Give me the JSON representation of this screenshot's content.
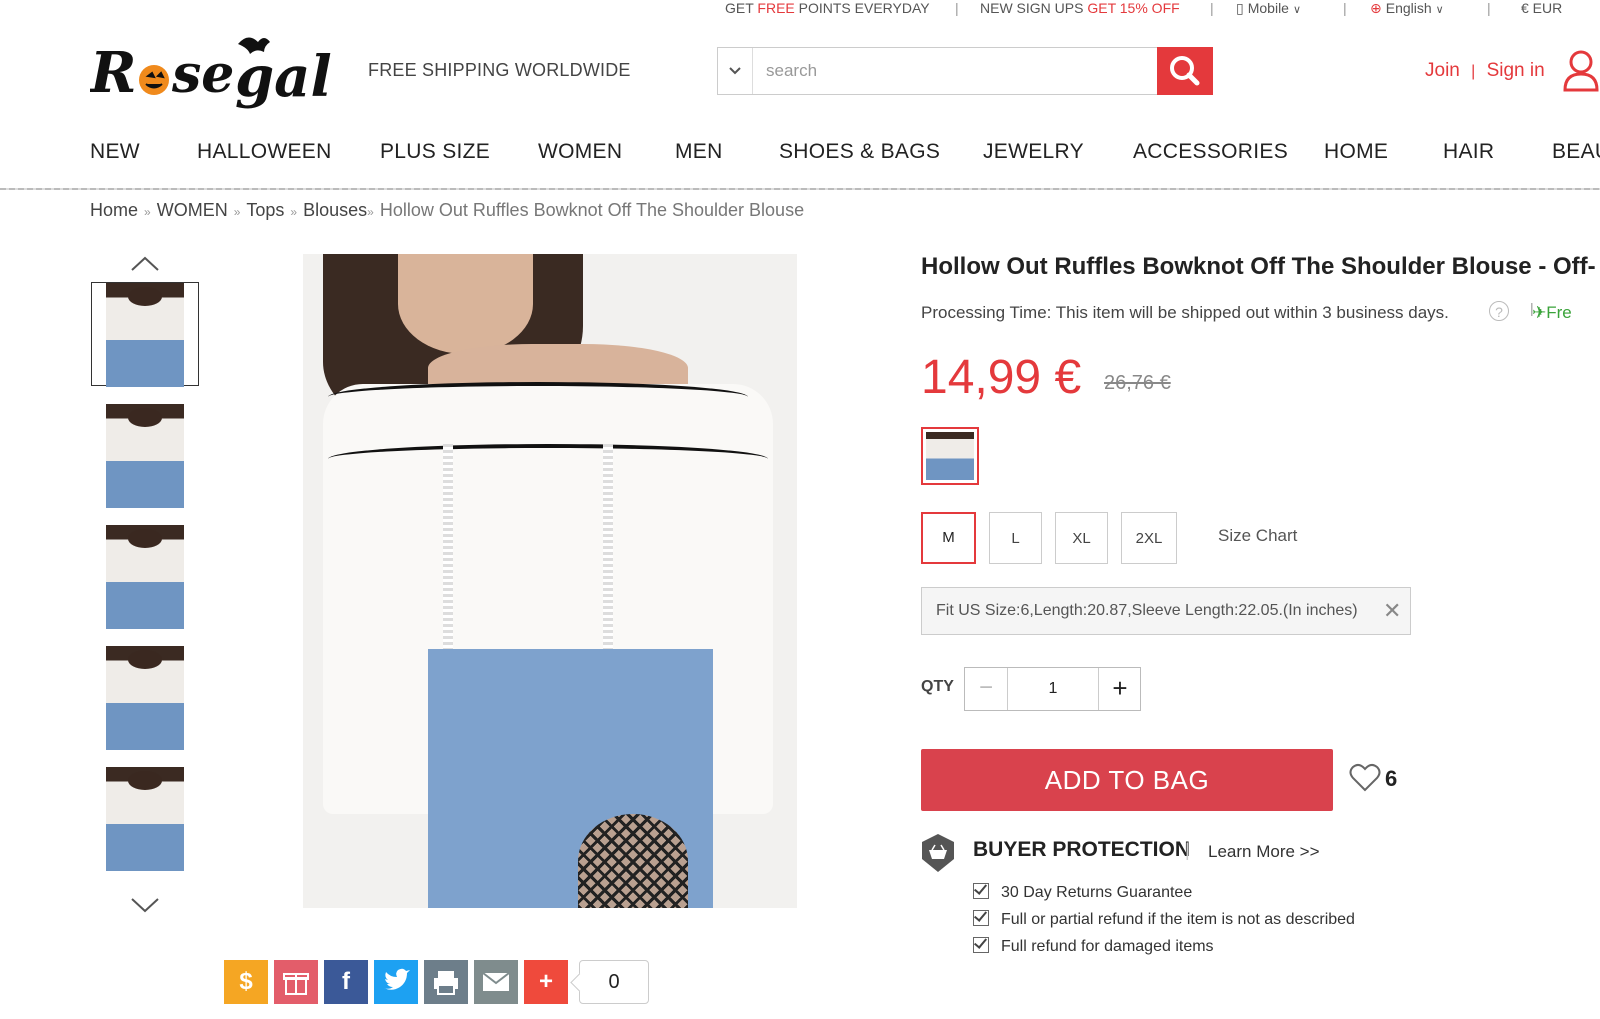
{
  "topbar": {
    "points_a": "GET ",
    "points_b": "FREE",
    "points_c": " POINTS EVERYDAY",
    "signup_a": "NEW SIGN UPS ",
    "signup_b": "GET 15% OFF",
    "mobile": "Mobile",
    "language": "English",
    "currency": "€ EUR"
  },
  "header": {
    "logo_text": "Rosegal",
    "free_shipping": "FREE SHIPPING WORLDWIDE",
    "search_placeholder": "search",
    "join": "Join",
    "signin": "Sign in"
  },
  "nav": [
    "NEW",
    "HALLOWEEN",
    "PLUS SIZE",
    "WOMEN",
    "MEN",
    "SHOES & BAGS",
    "JEWELRY",
    "ACCESSORIES",
    "HOME",
    "HAIR",
    "BEAU"
  ],
  "breadcrumb": {
    "home": "Home",
    "women": "WOMEN",
    "tops": "Tops",
    "blouses": "Blouses",
    "current": "Hollow Out Ruffles Bowknot Off The Shoulder Blouse"
  },
  "product": {
    "title": "Hollow Out Ruffles Bowknot Off The Shoulder Blouse - Off-",
    "processing": "Processing Time: This item will be shipped out within 3 business days.",
    "help": "?",
    "free": "Fre",
    "price": "14,99 €",
    "old_price": "26,76 €",
    "sizes": [
      "M",
      "L",
      "XL",
      "2XL"
    ],
    "selected_size": "M",
    "size_chart": "Size Chart",
    "fit": "Fit US Size:6,Length:20.87,Sleeve Length:22.05.(In inches)",
    "qty_label": "QTY",
    "qty": "1",
    "add_to_bag": "ADD TO BAG",
    "wish_count": "6"
  },
  "protection": {
    "title": "BUYER PROTECTION",
    "learn_more": "Learn More >>",
    "items": [
      "30 Day Returns Guarantee",
      "Full or partial refund if the item is not as described",
      "Full refund for damaged items"
    ]
  },
  "share": {
    "count": "0"
  },
  "colors": {
    "accent": "#e4393c",
    "button": "#d9424d",
    "facebook": "#3b5998",
    "twitter": "#1da1f2"
  }
}
